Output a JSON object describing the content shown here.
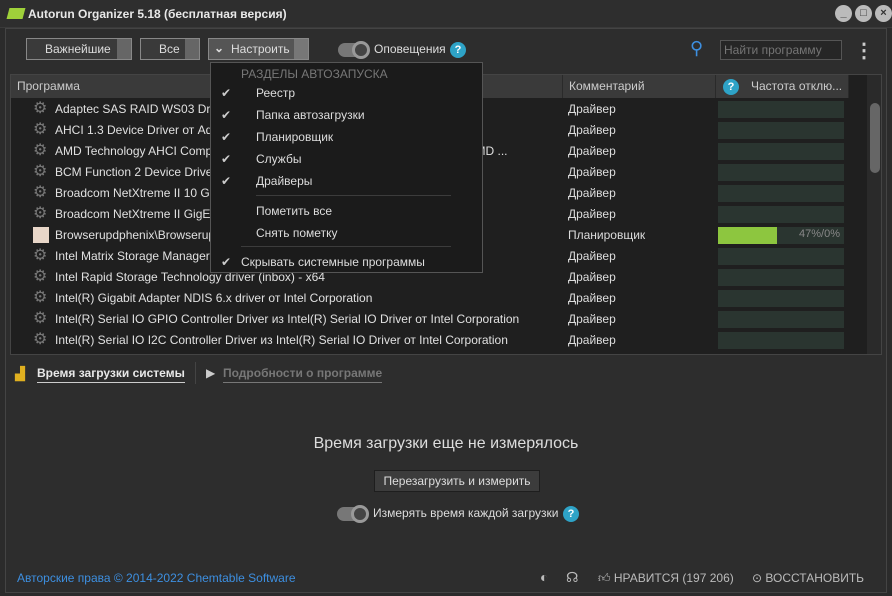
{
  "window": {
    "title": "Autorun Organizer 5.18 (бесплатная версия)",
    "minimize": "_",
    "maximize": "□",
    "close": "×"
  },
  "toolbar": {
    "important": "Важнейшие",
    "all": "Все",
    "customize": "Настроить",
    "notifications": "Оповещения",
    "help": "?",
    "search_placeholder": "Найти программу",
    "more": "⋮"
  },
  "table": {
    "columns": [
      "Программа",
      "Комментарий",
      "Частота отклю..."
    ],
    "help": "?",
    "rows": [
      {
        "name": "Adaptec SAS RAID WS03 Driver",
        "comment": "Драйвер"
      },
      {
        "name": "AHCI 1.3 Device Driver от Advanced Micro Devices",
        "comment": "Драйвер"
      },
      {
        "name": "AMD Technology AHCI Compatible Controller Driver for Windows Platform от AMD ...",
        "comment": "Драйвер"
      },
      {
        "name": "BCM Function 2  Device Driver",
        "comment": "Драйвер"
      },
      {
        "name": "Broadcom NetXtreme II 10 GigE",
        "comment": "Драйвер"
      },
      {
        "name": "Broadcom NetXtreme II GigE",
        "comment": "Драйвер"
      },
      {
        "name": "Browserupdphenix\\Browserupdphenix",
        "comment": "Планировщик",
        "freq": 0.47,
        "freq_label": "47%/0%"
      },
      {
        "name": "Intel Matrix Storage Manager",
        "comment": "Драйвер"
      },
      {
        "name": "Intel Rapid Storage Technology driver (inbox) - x64",
        "comment": "Драйвер"
      },
      {
        "name": "Intel(R) Gigabit Adapter NDIS 6.x driver от Intel Corporation",
        "comment": "Драйвер"
      },
      {
        "name": "Intel(R) Serial IO GPIO Controller Driver из Intel(R) Serial IO Driver от Intel Corporation",
        "comment": "Драйвер"
      },
      {
        "name": "Intel(R) Serial IO I2C Controller Driver из Intel(R) Serial IO Driver от Intel Corporation",
        "comment": "Драйвер"
      }
    ]
  },
  "menu": {
    "header": "РАЗДЕЛЫ АВТОЗАПУСКА",
    "items": [
      {
        "label": "Реестр",
        "checked": true
      },
      {
        "label": "Папка автозагрузки",
        "checked": true
      },
      {
        "label": "Планировщик",
        "checked": true
      },
      {
        "label": "Службы",
        "checked": true
      },
      {
        "label": "Драйверы",
        "checked": true
      }
    ],
    "mark_all": "Пометить все",
    "unmark": "Снять пометку",
    "hide_system": "Скрывать системные программы",
    "check": "✔"
  },
  "bottom": {
    "tab_boot": "Время загрузки системы",
    "tab_details": "Подробности о программе",
    "message": "Время загрузки еще не измерялось",
    "reboot_button": "Перезагрузить и измерить",
    "measure_each": "Измерять время каждой загрузки"
  },
  "status": {
    "copyright": "Авторские права © 2014-2022 Chemtable Software",
    "like": "НРАВИТСЯ (197 206)",
    "restore": "ВОССТАНОВИТЬ"
  },
  "colors": {
    "accent": "#8dc63f",
    "link": "#3d8fe0",
    "help": "#2ea3c7"
  }
}
